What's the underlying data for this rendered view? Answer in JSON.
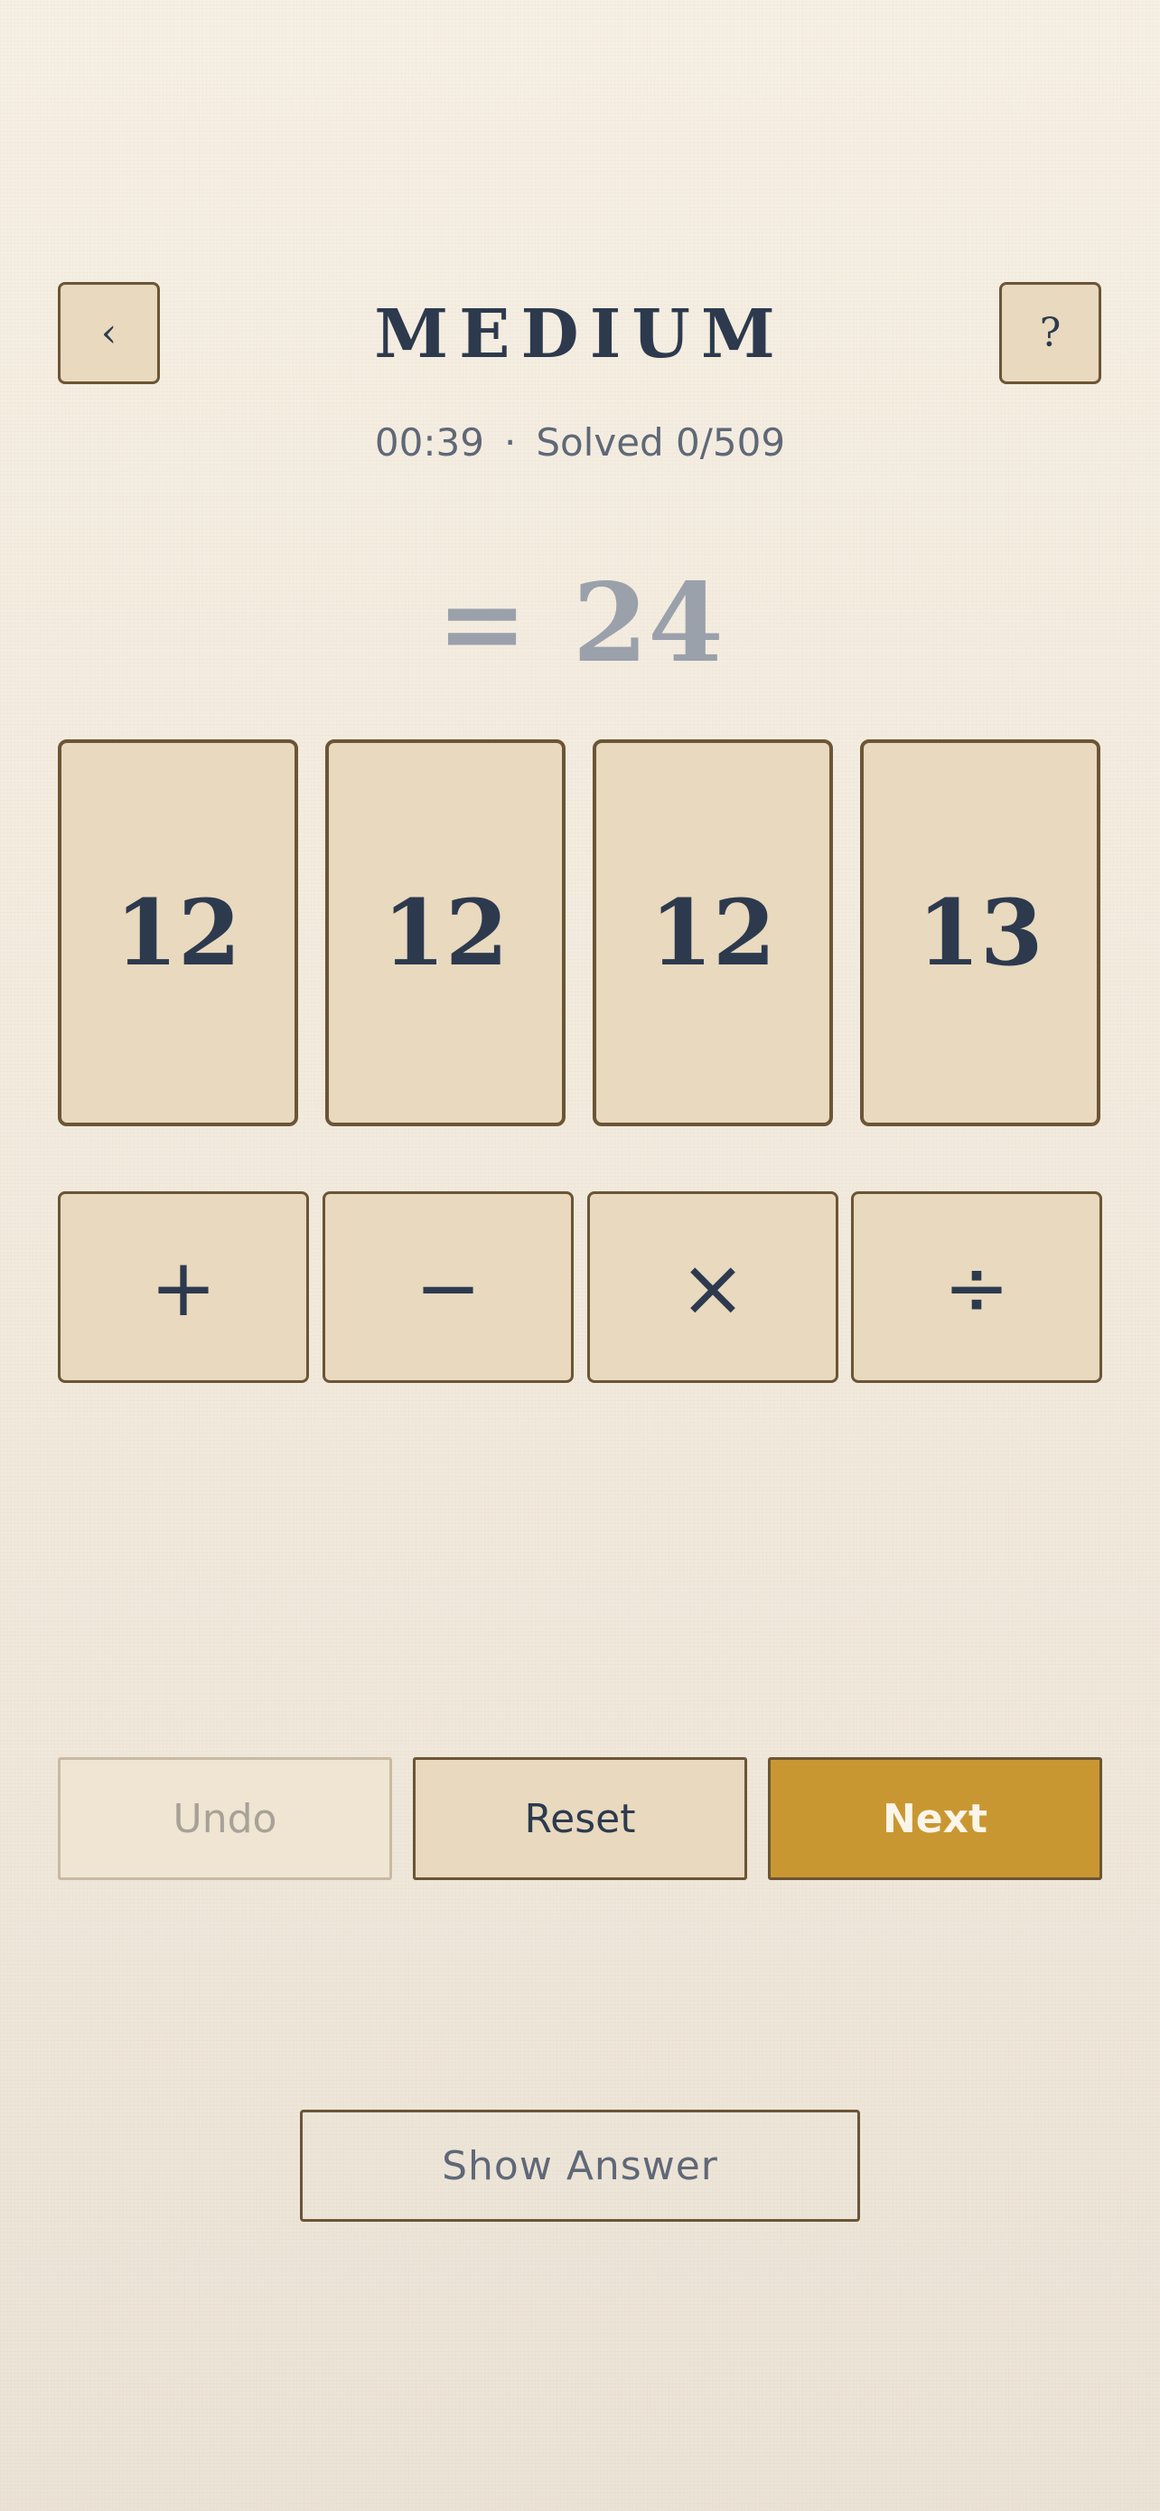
{
  "header": {
    "back_icon": "‹",
    "help_icon": "?",
    "title": "MEDIUM"
  },
  "status": {
    "timer": "00:39",
    "separator": "·",
    "solved": "Solved 0/509"
  },
  "target": {
    "equals": "=",
    "value": "24"
  },
  "cards": [
    "12",
    "12",
    "12",
    "13"
  ],
  "operators": {
    "add": "+",
    "subtract": "−",
    "multiply": "×",
    "divide": "÷"
  },
  "actions": {
    "undo": "Undo",
    "reset": "Reset",
    "next": "Next",
    "show_answer": "Show Answer"
  },
  "colors": {
    "background": "#f4ede1",
    "card_fill": "#e8d9bf",
    "border": "#6b5535",
    "accent": "#c99732",
    "text": "#2d3a4e",
    "muted": "#9aa1ab"
  }
}
